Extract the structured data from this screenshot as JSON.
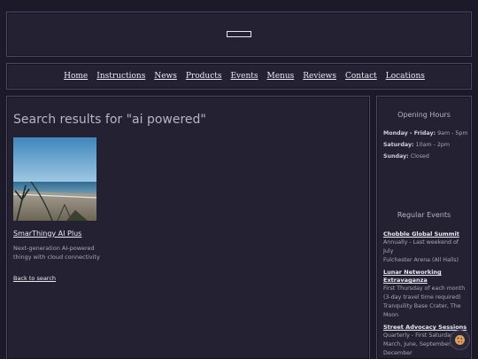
{
  "nav": {
    "items": [
      "Home",
      "Instructions",
      "News",
      "Products",
      "Events",
      "Menus",
      "Reviews",
      "Contact",
      "Locations"
    ]
  },
  "search": {
    "title": "Search results for \"ai powered\"",
    "back_label": "Back to search"
  },
  "product": {
    "name": "SmarThingy AI Plus",
    "description": "Next-generation AI-powered thingy with cloud connectivity"
  },
  "sidebar": {
    "hours_heading": "Opening Hours",
    "hours": [
      {
        "day": "Monday - Friday:",
        "time": "9am - 5pm"
      },
      {
        "day": "Saturday:",
        "time": "10am - 2pm"
      },
      {
        "day": "Sunday:",
        "time": "Closed"
      }
    ],
    "events_heading": "Regular Events",
    "events": [
      {
        "name": "Chobble Global Summit",
        "details": [
          "Annually - Last weekend of July",
          "Fulchester Arena (All Halls)"
        ]
      },
      {
        "name": "Lunar Networking Extravaganza",
        "details": [
          "First Thursday of each month (3-day travel time required)",
          "Tranquility Base Crater, The Moon"
        ]
      },
      {
        "name": "Street Advocacy Sessions",
        "details": [
          "Quarterly - First Saturday of March, June, September, December"
        ]
      }
    ]
  },
  "icons": {
    "logo": "logo-placeholder",
    "cookie": "cookie-icon"
  },
  "colors": {
    "background": "#1c1a29",
    "panel": "#242133",
    "border": "#4b4866",
    "link": "#ecebf3"
  }
}
